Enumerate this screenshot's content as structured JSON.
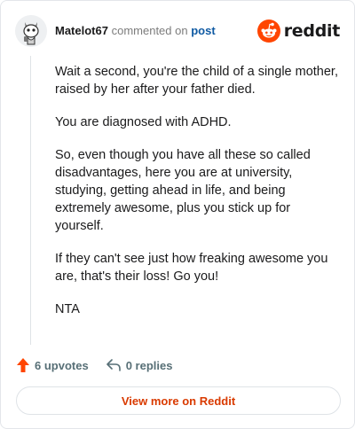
{
  "header": {
    "username": "Matelot67",
    "commented_text": "commented on",
    "post_link": "post",
    "logo_text": "reddit"
  },
  "comment": {
    "paragraphs": [
      "Wait a second, you're the child of a single mother, raised by her after your father died.",
      "You are diagnosed with ADHD.",
      "So, even though you have all these so called disadvantages, here you are at university, studying, getting ahead in life, and being extremely awesome, plus you stick up for yourself.",
      "If they can't see just how freaking awesome you are, that's their loss! Go you!",
      "NTA"
    ]
  },
  "actions": {
    "upvotes": "6 upvotes",
    "replies": "0 replies"
  },
  "footer": {
    "view_more": "View more on Reddit"
  },
  "colors": {
    "brand": "#ff4500",
    "link": "#0f5aa3",
    "view_more_text": "#d93a00"
  }
}
